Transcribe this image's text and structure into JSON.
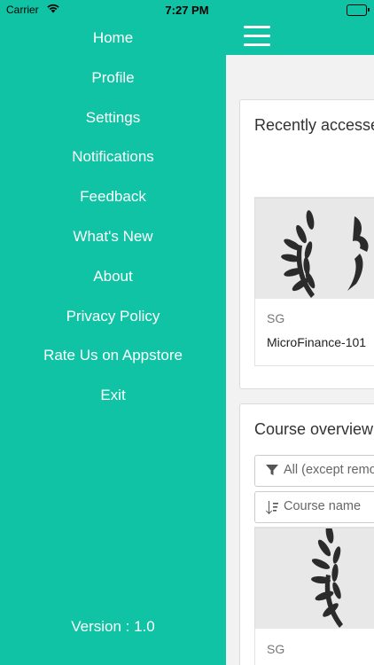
{
  "status_bar": {
    "carrier": "Carrier",
    "time": "7:27 PM"
  },
  "drawer": {
    "items": [
      {
        "label": "Home"
      },
      {
        "label": "Profile"
      },
      {
        "label": "Settings"
      },
      {
        "label": "Notifications"
      },
      {
        "label": "Feedback"
      },
      {
        "label": "What's New"
      },
      {
        "label": "About"
      },
      {
        "label": "Privacy Policy"
      },
      {
        "label": "Rate Us on Appstore"
      },
      {
        "label": "Exit"
      }
    ],
    "version": "Version : 1.0"
  },
  "main": {
    "recent": {
      "title": "Recently accessed courses",
      "course": {
        "category": "SG",
        "name": "MicroFinance-101"
      }
    },
    "overview": {
      "title": "Course overview",
      "filter_label": "All (except removed from view)",
      "sort_label": "Course name",
      "course": {
        "category": "SG"
      }
    }
  },
  "colors": {
    "accent": "#0fc3a4",
    "content_bg": "#f2f2f2"
  }
}
